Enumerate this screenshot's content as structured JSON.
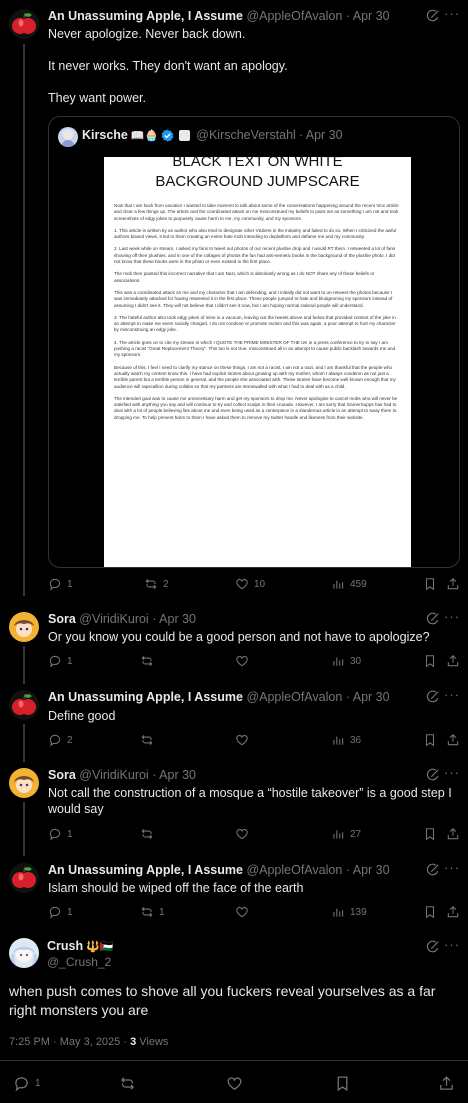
{
  "posts": [
    {
      "author": "An Unassuming Apple, I Assume",
      "handle": "@AppleOfAvalon",
      "date": "· Apr 30",
      "lines": [
        "Never apologize. Never back down.",
        "It never works. They don't want an apology.",
        "They want power."
      ],
      "quote": {
        "author": "Kirsche",
        "badges": "📖🧁",
        "handle": "@KirscheVerstahl",
        "date": "· Apr 30",
        "doc_title_1": "BLACK TEXT ON WHITE",
        "doc_title_2": "BACKGROUND JUMPSCARE",
        "doc_paragraphs": [
          "Now that I am back from vacation I wanted to take moment to talk about some of the conversations happening around the recent Vice article and clear a few things up. The article and the coordinated attack on me misconstrued my beliefs to paint me as something I am not and took screenshots of edgy jokes to purposely cause harm to me, my community, and my sponsors.",
          "1. This article is written by an author who also tried to denigrate other Vtubers in the industry and failed to do so. When I criticized the awful authors biased views, it led to them creating an entire hate mob intending to deplatform and defame me and my community.",
          "2. Last week while on stream, I asked my fans to tweet out photos of our recent plushie drop and I would RT them. I retweeted a lot of fans showing off their plushies, and in one of the collages of photos the fan had anti-semetic books in the background of the plushie photo. I did not know that these books were in the photo or even existed in the first place.",
          "The mob then painted this incorrect narrative that I am Nazi, which is absolutely wrong as I do NOT share any of these beliefs or associations.",
          "This was a coordinated attack on me and my character that I am defending, and I initially did not want to un-retweet the photos because I was immediately attacked for having retweeted it in the first place. These people jumped to hate and bludgeoning my sponsors instead of assuming I didn't see it. They will not believe that I didn't see it now, but I am hoping normal rational people will understand.",
          "3. The hateful author also took edgy jokes of mine in a vacuum, leaving out the tweets above and below that provided context of the joke in an attempt to make me seem racially charged. I do not condone or promote racism and this was again, a poor attempt to hurt my character by misconstruing an edgy joke.",
          "4. The article goes on to cite my stream in which I QUOTE THE PRIME MINISTER OF THE UK in a press conference to try to say I am pushing a racist \"Great Replacement Theory\". This too is not true, misconstrued all in an attempt to cause public backlash towards me and my sponsors.",
          "Because of this, I feel I need to clarify my stance on these things. I am not a racist, I am not a nazi, and I am thankful that the people who actually watch my content know this. I have had explicit stories about growing up with my mother, whom I always condemn as not just a terrible parent but a terrible person in general, and the people she associated with. These stories have become well known enough that my audience will rapscallion during collabs so that my partners are stonewalled with what I had to deal with as a child.",
          "The intended goal was to cause me unnecessary harm and get my sponsors to drop me. Never apologise to cancel mobs who will never be satisfied with anything you say and will continue to try and collect scalps in their crusade. However, I am sorry that GamerSupps has had to deal with a lot of people believing lies about me and even being used as a centerpiece in a slanderous article in an attempt to sway them to dropping me. To help prevent harm to them I have asked them to remove my twitter handle and likeness from their website."
        ]
      },
      "replies": "1",
      "reposts": "2",
      "likes": "10",
      "views": "459"
    },
    {
      "author": "Sora",
      "handle": "@ViridiKuroi",
      "date": "· Apr 30",
      "text": "Or you know you could be a good person and not have to apologize?",
      "replies": "1",
      "reposts": "",
      "likes": "",
      "views": "30"
    },
    {
      "author": "An Unassuming Apple, I Assume",
      "handle": "@AppleOfAvalon",
      "date": "· Apr 30",
      "text": "Define good",
      "replies": "2",
      "reposts": "",
      "likes": "",
      "views": "36"
    },
    {
      "author": "Sora",
      "handle": "@ViridiKuroi",
      "date": "· Apr 30",
      "text": "Not call the construction of a mosque a “hostile takeover” is a good step I would say",
      "replies": "1",
      "reposts": "",
      "likes": "",
      "views": "27"
    },
    {
      "author": "An Unassuming Apple, I Assume",
      "handle": "@AppleOfAvalon",
      "date": "· Apr 30",
      "text": "Islam should be wiped off the face of the earth",
      "replies": "1",
      "reposts": "1",
      "likes": "",
      "views": "139"
    }
  ],
  "main": {
    "author": "Crush",
    "badges": "🔱🇵🇸",
    "handle": "@_Crush_2",
    "text": "when push comes to shove all you fuckers reveal yourselves as a far right monsters you are",
    "time": "7:25 PM · May 3, 2025 · ",
    "views_count": "3",
    "views_label": " Views",
    "replies": "1"
  },
  "colors": {
    "background": "#000000",
    "text": "#e7e9ea",
    "muted": "#71767b",
    "verified": "#1d9bf0",
    "border": "#2f3336"
  },
  "icons": [
    "apple-avatar",
    "grok-icon",
    "more-icon",
    "reply-icon",
    "repost-icon",
    "like-icon",
    "views-icon",
    "bookmark-icon",
    "share-icon",
    "verified-badge-icon"
  ]
}
